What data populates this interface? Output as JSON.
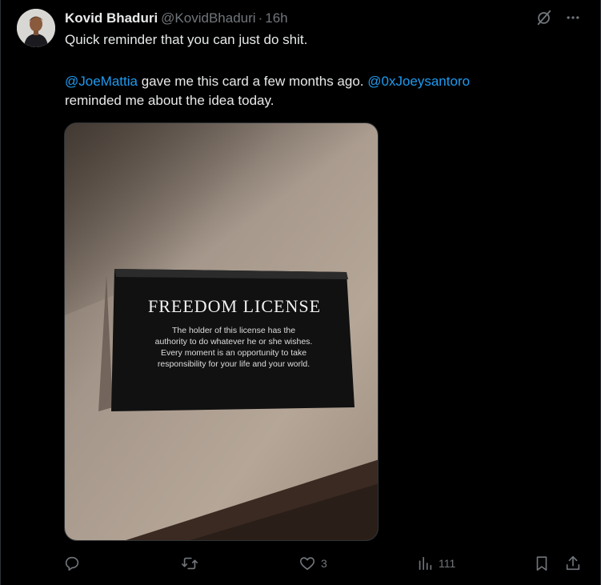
{
  "tweet": {
    "author_name": "Kovid Bhaduri",
    "author_handle": "@KovidBhaduri",
    "separator": "·",
    "time": "16h",
    "line1": "Quick reminder that you can just do shit.",
    "mention1": "@JoeMattia",
    "line2_mid": " gave me this card a few months ago. ",
    "mention2": "@0xJoeysantoro",
    "line3": "reminded me about the idea today."
  },
  "card": {
    "title": "FREEDOM LICENSE",
    "body_lines": [
      "The holder of this license has the",
      "authority to do whatever he or she wishes.",
      "Every moment is an opportunity to take",
      "responsibility for your life and your world."
    ]
  },
  "actions": {
    "reply_count": "",
    "retweet_count": "",
    "like_count": "3",
    "views_count": "111"
  },
  "icons": {
    "grok": "grok-icon",
    "more": "more-icon",
    "reply": "reply-icon",
    "retweet": "retweet-icon",
    "like": "heart-icon",
    "views": "views-icon",
    "bookmark": "bookmark-icon",
    "share": "share-icon"
  },
  "colors": {
    "background": "#000000",
    "text": "#e7e9ea",
    "muted": "#71767b",
    "link": "#1d9bf0",
    "border": "#2f3336"
  }
}
